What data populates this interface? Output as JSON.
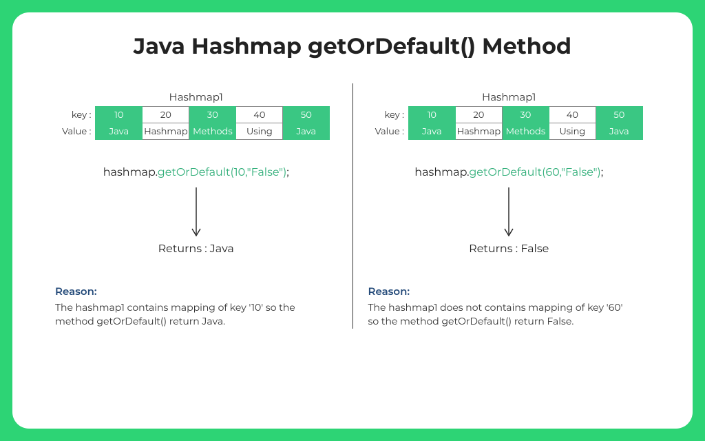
{
  "title": "Java Hashmap getOrDefault() Method",
  "labels": {
    "key": "key :",
    "value": "Value :",
    "reason": "Reason:"
  },
  "hashmap_name": "Hashmap1",
  "table": {
    "keys": [
      {
        "v": "10",
        "g": true
      },
      {
        "v": "20",
        "g": false
      },
      {
        "v": "30",
        "g": true
      },
      {
        "v": "40",
        "g": false
      },
      {
        "v": "50",
        "g": true
      }
    ],
    "values": [
      {
        "v": "Java",
        "g": true
      },
      {
        "v": "Hashmap",
        "g": false
      },
      {
        "v": "Methods",
        "g": true
      },
      {
        "v": "Using",
        "g": false
      },
      {
        "v": "Java",
        "g": true
      }
    ]
  },
  "left": {
    "call_prefix": "hashmap.",
    "call_hl": "getOrDefault(10,\"False\")",
    "call_suffix": ";",
    "returns": "Returns : Java",
    "reason": "The hashmap1 contains mapping of key '10' so the method getOrDefault() return Java."
  },
  "right": {
    "call_prefix": "hashmap.",
    "call_hl": "getOrDefault(60,\"False\")",
    "call_suffix": ";",
    "returns": "Returns : False",
    "reason": "The hashmap1 does not contains mapping of key '60' so the method getOrDefault() return False."
  }
}
